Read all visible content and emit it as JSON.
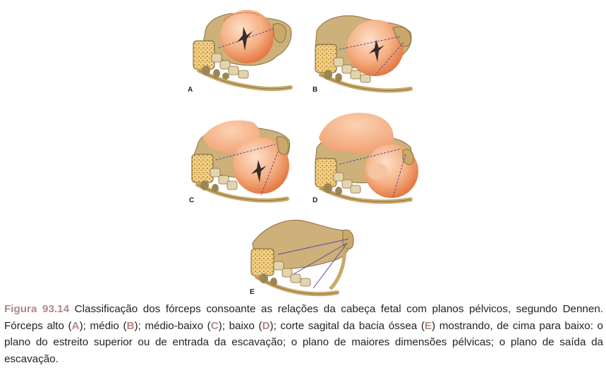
{
  "colors": {
    "bone": "#c9a86a",
    "bone_dark": "#8d7140",
    "marrow": "#e8c070",
    "head": "#ee9a66",
    "head_light": "#fbd7b8",
    "plane_line": "#5a4aa0",
    "caption_accent": "#b08a87",
    "caption_text": "#231f20"
  },
  "panels": [
    {
      "letter": "A"
    },
    {
      "letter": "B"
    },
    {
      "letter": "C"
    },
    {
      "letter": "D"
    },
    {
      "letter": "E"
    }
  ],
  "caption": {
    "figure_label": "Figura 93.14",
    "t1": " Classificação dos fórceps consoante as relações da cabeça fetal com planos pélvicos, segundo Dennen. Fórceps alto (",
    "rA": "A",
    "t2": "); médio (",
    "rB": "B",
    "t3": "); médio-baixo (",
    "rC": "C",
    "t4": "); baixo (",
    "rD": "D",
    "t5": "); corte sagital da bacia óssea (",
    "rE": "E",
    "t6": ") mostrando, de cima para baixo: o plano do estreito superior ou de entrada da escavação; o plano de maiores dimensões pélvicas; o plano de saída da escavação."
  }
}
